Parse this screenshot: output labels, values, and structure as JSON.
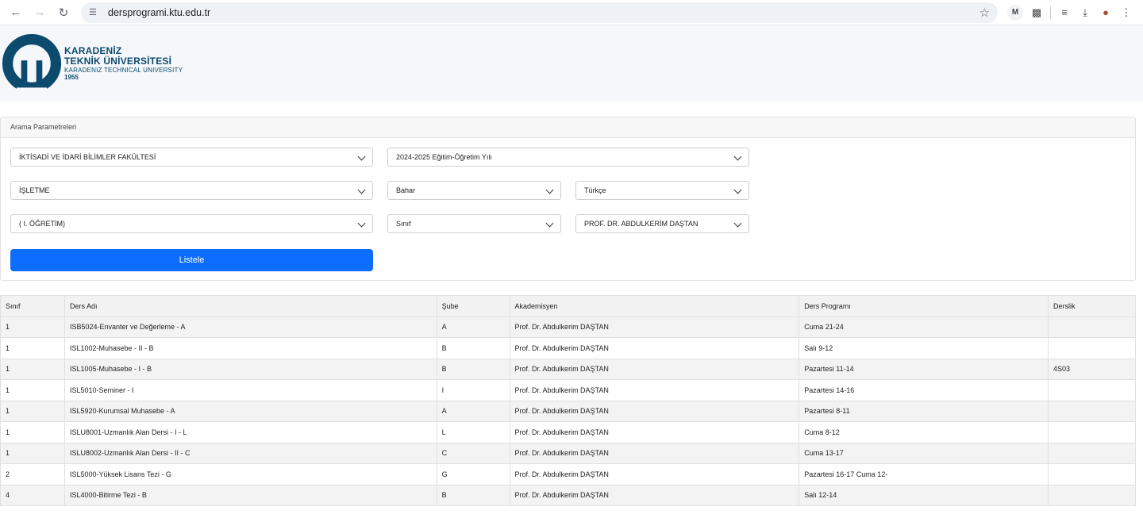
{
  "browser": {
    "url": "dersprogrami.ktu.edu.tr",
    "ext_m": "M"
  },
  "header": {
    "brand_line1": "KARADENİZ",
    "brand_line2": "TEKNİK ÜNİVERSİTESİ",
    "brand_line3": "KARADENIZ TECHNICAL UNIVERSITY",
    "brand_year": "1955",
    "brand_color": "#0c4a6e"
  },
  "search": {
    "panel_title": "Arama Parametreleri",
    "faculty": "İKTİSADİ VE İDARİ BİLİMLER FAKÜLTESİ",
    "year": "2024-2025 Eğitim-Öğretim Yılı",
    "department": "İŞLETME",
    "term": "Bahar",
    "language": "Türkçe",
    "program": "( I. ÖĞRETİM)",
    "class": "Sınıf",
    "instructor": "PROF. DR. ABDULKERİM DAŞTAN",
    "submit_label": "Listele",
    "accent": "#0d6efd"
  },
  "table": {
    "headers": [
      "Sınıf",
      "Ders Adı",
      "Şube",
      "Akademisyen",
      "Ders Programı",
      "Derslik"
    ],
    "rows": [
      [
        "1",
        "ISB5024-Envanter ve Değerleme - A",
        "A",
        "Prof. Dr. Abdulkerim DAŞTAN",
        "Cuma 21-24",
        ""
      ],
      [
        "1",
        "ISL1002-Muhasebe - II - B",
        "B",
        "Prof. Dr. Abdulkerim DAŞTAN",
        "Salı 9-12",
        ""
      ],
      [
        "1",
        "ISL1005-Muhasebe - I - B",
        "B",
        "Prof. Dr. Abdulkerim DAŞTAN",
        "Pazartesi 11-14",
        "4S03"
      ],
      [
        "1",
        "ISL5010-Seminer - I",
        "I",
        "Prof. Dr. Abdulkerim DAŞTAN",
        "Pazartesi 14-16",
        ""
      ],
      [
        "1",
        "ISL5920-Kurumsal Muhasebe - A",
        "A",
        "Prof. Dr. Abdulkerim DAŞTAN",
        "Pazartesi 8-11",
        ""
      ],
      [
        "1",
        "ISLU8001-Uzmanlık Alan Dersi - I - L",
        "L",
        "Prof. Dr. Abdulkerim DAŞTAN",
        "Cuma 8-12",
        ""
      ],
      [
        "1",
        "ISLU8002-Uzmanlık Alan Dersi - II - C",
        "C",
        "Prof. Dr. Abdulkerim DAŞTAN",
        "Cuma 13-17",
        ""
      ],
      [
        "2",
        "ISL5000-Yüksek Lisans Tezi - G",
        "G",
        "Prof. Dr. Abdulkerim DAŞTAN",
        "Pazartesi 16-17 Cuma 12-",
        ""
      ],
      [
        "4",
        "ISL4000-Bitirme Tezi - B",
        "B",
        "Prof. Dr. Abdulkerim DAŞTAN",
        "Salı 12-14",
        ""
      ]
    ]
  }
}
